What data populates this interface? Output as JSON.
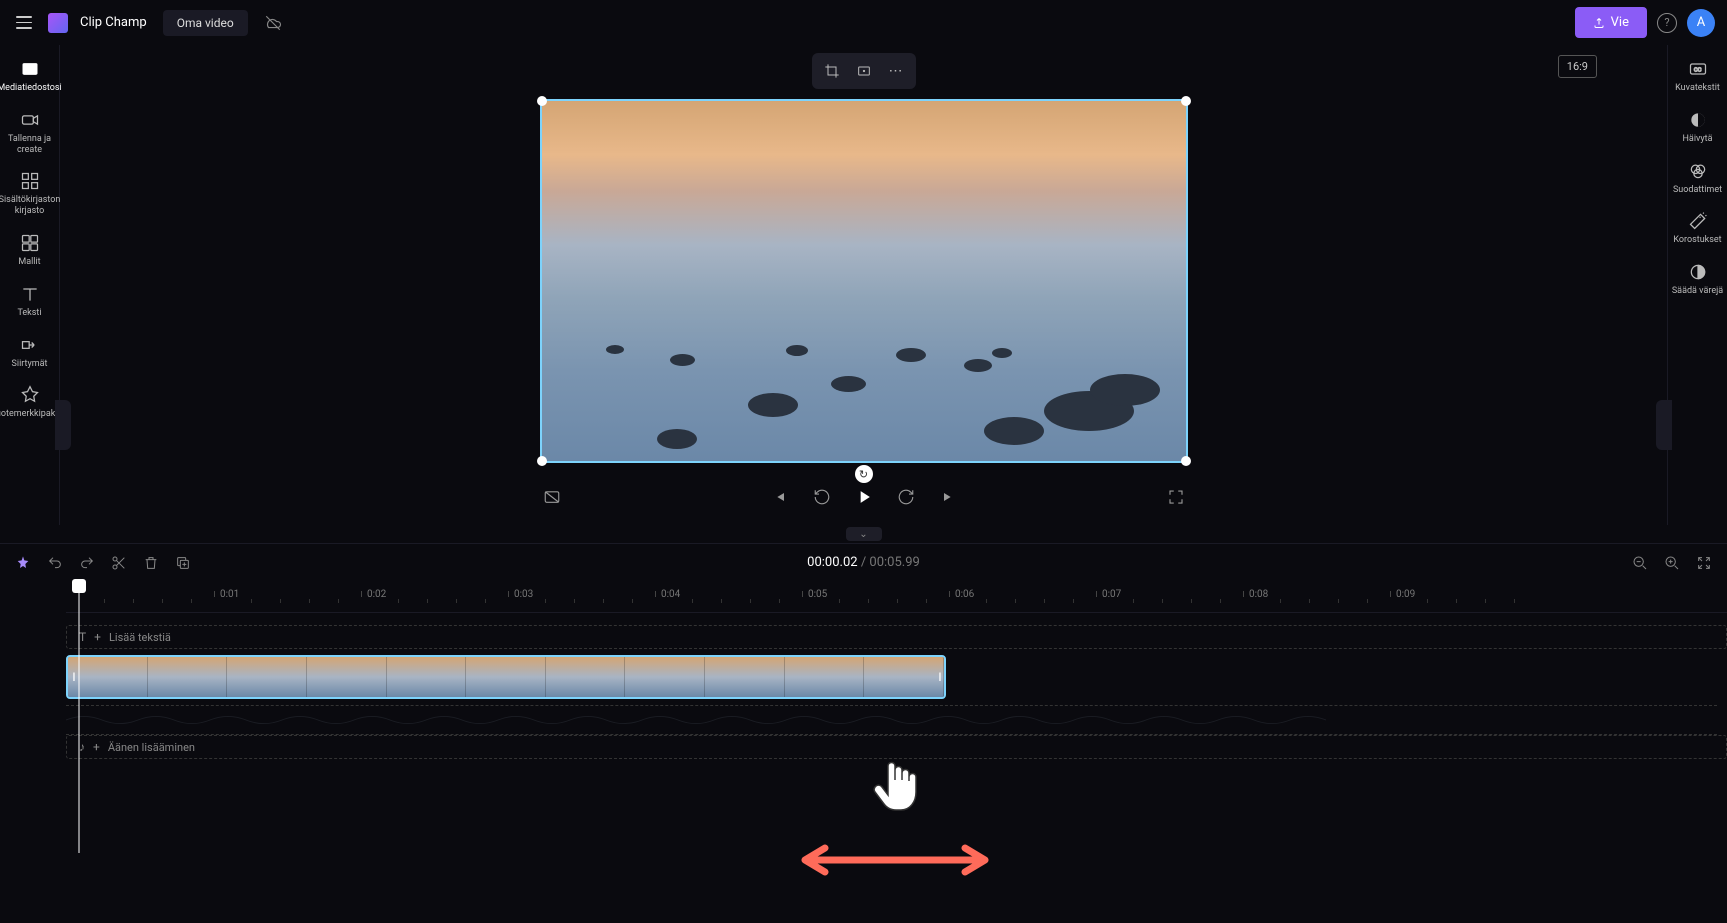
{
  "header": {
    "app_name": "Clip Champ",
    "project_name": "Oma video",
    "export_label": "Vie",
    "avatar_letter": "A",
    "aspect_ratio": "16:9"
  },
  "left_sidebar": {
    "items": [
      {
        "label": "Mediatiedostosi"
      },
      {
        "label": "Tallenna ja create"
      },
      {
        "label": "Sisältökirjaston kirjasto"
      },
      {
        "label": "Mallit"
      },
      {
        "label": "Teksti"
      },
      {
        "label": "Siirtymät"
      },
      {
        "label": "Tuotemerkkipaketti"
      }
    ]
  },
  "right_sidebar": {
    "items": [
      {
        "label": "Kuvatekstit"
      },
      {
        "label": "Häivytä"
      },
      {
        "label": "Suodattimet"
      },
      {
        "label": "Korostukset"
      },
      {
        "label": "Säädä värejä"
      }
    ]
  },
  "timeline": {
    "current_time": "00:00.02",
    "total_time": "00:05.99",
    "ruler_ticks": [
      "0:01",
      "0:02",
      "0:03",
      "0:04",
      "0:05",
      "0:06",
      "0:07",
      "0:08",
      "0:09"
    ],
    "text_track_label": "Lisää tekstiä",
    "audio_track_label": "Äänen lisääminen"
  }
}
